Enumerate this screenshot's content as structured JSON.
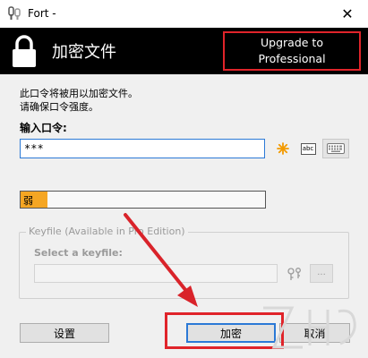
{
  "window": {
    "title": "Fort -",
    "close_glyph": "✕"
  },
  "banner": {
    "heading": "加密文件",
    "upgrade_line1": "Upgrade to",
    "upgrade_line2": "Professional"
  },
  "form": {
    "desc_line1": "此口令将被用以加密文件。",
    "desc_line2": "请确保口令强度。",
    "password_label": "输入口令:",
    "password_value": "***",
    "abc_text": "abc"
  },
  "strength": {
    "label": "弱",
    "level": 0.11,
    "color": "#f5a623"
  },
  "keyfile": {
    "legend": "Keyfile (Available in Pro Edition)",
    "select_label": "Select a keyfile:",
    "browse_label": "..."
  },
  "buttons": {
    "settings": "设置",
    "encrypt": "加密",
    "cancel": "取消"
  },
  "colors": {
    "banner_bg": "#000000",
    "highlight": "#e0242a",
    "focus": "#2b79d6"
  },
  "icons": [
    "app-key-icon",
    "lock-icon",
    "close-icon",
    "star-generate-icon",
    "abc-icon",
    "keyboard-icon",
    "key-icon"
  ]
}
